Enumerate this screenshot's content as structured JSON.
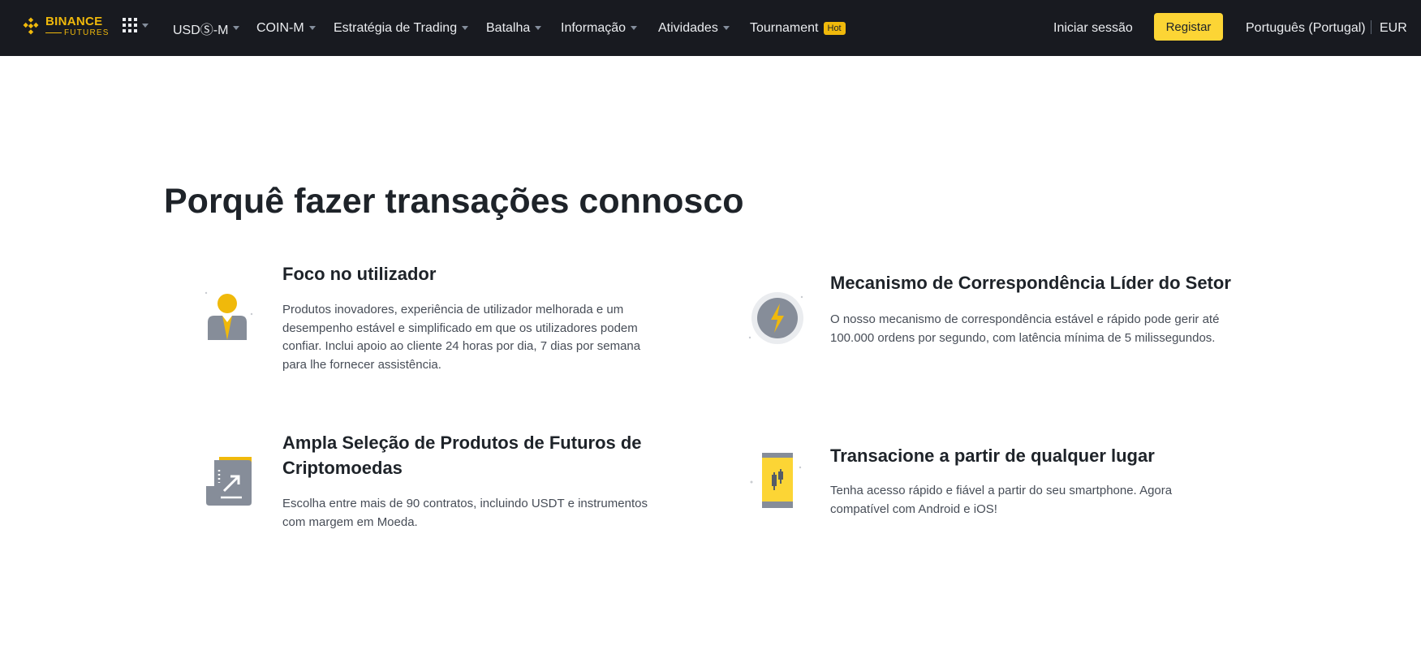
{
  "nav": {
    "brand_main": "BINANCE",
    "brand_sub": "FUTURES",
    "items": [
      {
        "label": "USDⓈ-M"
      },
      {
        "label": "COIN-M"
      },
      {
        "label": "Estratégia de Trading"
      },
      {
        "label": "Batalha"
      },
      {
        "label": "Informação"
      },
      {
        "label": "Atividades"
      },
      {
        "label": "Tournament",
        "badge": "Hot"
      }
    ],
    "login": "Iniciar sessão",
    "register": "Registar",
    "language": "Português (Portugal)",
    "currency": "EUR"
  },
  "section": {
    "title": "Porquê fazer transações connosco",
    "features": [
      {
        "icon": "user-focus-icon",
        "title": "Foco no utilizador",
        "description": "Produtos inovadores, experiência de utilizador melhorada e um desempenho estável e simplificado em que os utilizadores podem confiar. Inclui apoio ao cliente 24 horas por dia, 7 dias por semana para lhe fornecer assistência."
      },
      {
        "icon": "lightning-engine-icon",
        "title": "Mecanismo de Correspondência Líder do Setor",
        "description": "O nosso mecanismo de correspondência estável e rápido pode gerir até 100.000 ordens por segundo, com latência mínima de 5 milissegundos."
      },
      {
        "icon": "contract-chart-icon",
        "title": "Ampla Seleção de Produtos de Futuros de Criptomoedas",
        "description": "Escolha entre mais de 90 contratos, incluindo USDT e instrumentos com margem em Moeda."
      },
      {
        "icon": "mobile-trading-icon",
        "title": "Transacione a partir de qualquer lugar",
        "description": "Tenha acesso rápido e fiável a partir do seu smartphone. Agora compatível com Android e iOS!"
      }
    ]
  },
  "colors": {
    "nav_bg": "#181a20",
    "brand": "#f0b90b",
    "register_bg": "#fcd535",
    "text_primary": "#1e2329",
    "text_secondary": "#474d57"
  }
}
